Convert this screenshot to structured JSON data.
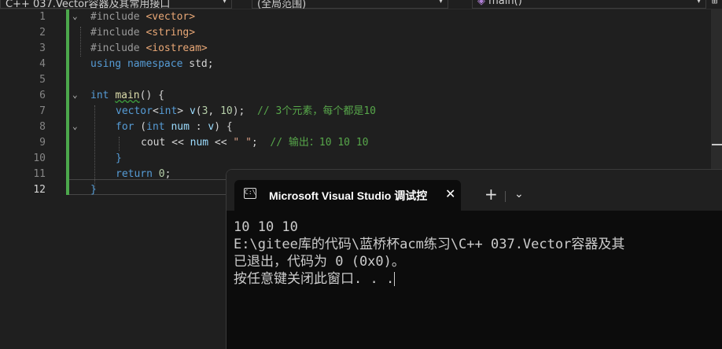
{
  "toolbar": {
    "project_dropdown": "C++ 037.Vector容器及其常用接口",
    "scope_dropdown": "(全局范围)",
    "member_dropdown": "main()"
  },
  "editor": {
    "line_numbers": [
      "1",
      "2",
      "3",
      "4",
      "5",
      "6",
      "7",
      "8",
      "9",
      "10",
      "11",
      "12"
    ],
    "current_line": "12",
    "lines": {
      "l1_pp": "#include ",
      "l1_inc": "<vector>",
      "l2_pp": "#include ",
      "l2_inc": "<string>",
      "l3_pp": "#include ",
      "l3_inc": "<iostream>",
      "l4_kw1": "using",
      "l4_kw2": "namespace",
      "l4_rest": " std;",
      "l6_type": "int",
      "l6_fn": "main",
      "l6_rest": "() {",
      "l7_a": "vector",
      "l7_b": "<",
      "l7_c": "int",
      "l7_d": "> ",
      "l7_e": "v",
      "l7_f": "(",
      "l7_g": "3",
      "l7_h": ", ",
      "l7_i": "10",
      "l7_j": ");  ",
      "l7_cm": "// 3个元素，每个都是10",
      "l8_a": "for",
      "l8_b": " (",
      "l8_c": "int",
      "l8_d": " ",
      "l8_e": "num",
      "l8_f": " : ",
      "l8_g": "v",
      "l8_h": ") {",
      "l9_a": "cout",
      "l9_b": " << ",
      "l9_c": "num",
      "l9_d": " << ",
      "l9_e": "\" \"",
      "l9_f": ";  ",
      "l9_cm": "// 输出：10 10 10",
      "l10": "}",
      "l11_kw": "return",
      "l11_sp": " ",
      "l11_num": "0",
      "l11_semi": ";",
      "l12": "}"
    }
  },
  "terminal": {
    "tab_title": "Microsoft Visual Studio 调试控",
    "tab_icon_text": "C:\\",
    "close_glyph": "✕",
    "new_tab_glyph": "+",
    "dropdown_glyph": "⌄",
    "output": [
      "10 10 10",
      "E:\\gitee库的代码\\蓝桥杯acm练习\\C++ 037.Vector容器及其",
      "已退出，代码为 0 (0x0)。",
      "按任意键关闭此窗口. . ."
    ]
  }
}
